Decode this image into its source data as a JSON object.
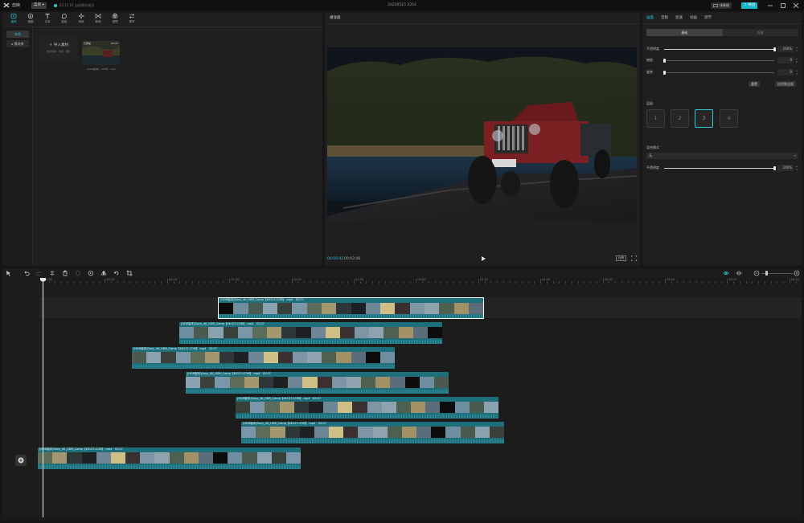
{
  "titlebar": {
    "app_name": "剪映",
    "menu_label": "菜单",
    "save_status": "23:15:07 自动保存成功",
    "project_title": "20210515 2254",
    "shortcut_label": "快捷键",
    "export_label": "导出"
  },
  "media": {
    "toolbar": [
      {
        "label": "媒体",
        "icon": "media-icon",
        "active": true
      },
      {
        "label": "音频",
        "icon": "audio-icon",
        "active": false
      },
      {
        "label": "文本",
        "icon": "text-icon",
        "active": false
      },
      {
        "label": "贴纸",
        "icon": "sticker-icon",
        "active": false
      },
      {
        "label": "特效",
        "icon": "effects-icon",
        "active": false
      },
      {
        "label": "转场",
        "icon": "transition-icon",
        "active": false
      },
      {
        "label": "滤镜",
        "icon": "filter-icon",
        "active": false
      },
      {
        "label": "调节",
        "icon": "adjust-icon",
        "active": false
      }
    ],
    "sidebar": {
      "local": "本地",
      "library": "素材库"
    },
    "import": {
      "label": "导入素材",
      "hint": "支持视频、音频、图片"
    },
    "thumb": {
      "badge": "已添加",
      "duration": "02:07",
      "filename": "[HDR版本]...COM】.mp4"
    }
  },
  "player": {
    "title": "播放器",
    "time_current": "00:00:02",
    "time_total": "00:03:46",
    "ratio_label": "比例"
  },
  "properties": {
    "tabs": [
      "画面",
      "音频",
      "变速",
      "动画",
      "调节"
    ],
    "active_tab": 0,
    "segments": [
      "基础",
      "抠像"
    ],
    "opacity_label": "不透明度",
    "opacity_value": "100%",
    "opacity": 1.0,
    "scale_label": "缩放",
    "scale_value": "0",
    "scale": 0.0,
    "rotate_label": "旋转",
    "rotate_value": "0",
    "rotate": 0.0,
    "reset_label": "重置",
    "apply_all_label": "应用到全部",
    "layer_label": "层级",
    "layers": [
      "1",
      "2",
      "3",
      "4"
    ],
    "active_layer": 2,
    "blend_label": "混合模式",
    "blend_value": "无",
    "blend_opacity_label": "不透明度",
    "blend_opacity_value": "100%",
    "blend_opacity": 1.0
  },
  "timeline": {
    "ruler_labels": [
      "00:00",
      "00:30",
      "01:00",
      "01:30",
      "02:00",
      "02:30",
      "03:00",
      "03:30",
      "04:00",
      "04:30",
      "05:00",
      "05:30",
      "06:00"
    ],
    "clips": [
      {
        "label": "[HDR版本]Sony_4K_HDR_Camp【4K123.COM】.mp4",
        "duration": "02:07",
        "selected": true
      },
      {
        "label": "[HDR版本]Sony_4K_HDR_Camp【4K123.COM】.mp4",
        "duration": "02:07",
        "selected": false
      },
      {
        "label": "[HDR版本]Sony_4K_HDR_Camp【4K123.COM】.mp4",
        "duration": "02:07",
        "selected": false
      },
      {
        "label": "[HDR版本]Sony_4K_HDR_Camp【4K123.COM】.mp4",
        "duration": "02:07",
        "selected": false
      },
      {
        "label": "[HDR版本]Sony_4K_HDR_Camp【4K123.COM】.mp4",
        "duration": "02:07",
        "selected": false
      },
      {
        "label": "[HDR版本]Sony_4K_HDR_Camp【4K123.COM】.mp4",
        "duration": "02:07",
        "selected": false
      },
      {
        "label": "[HDR版本]Sony_4K_HDR_Camp【4K123.COM】.mp4",
        "duration": "02:07",
        "selected": false
      }
    ]
  },
  "colors": {
    "accent": "#2ec4d6",
    "clip": "#1c6f7b"
  }
}
